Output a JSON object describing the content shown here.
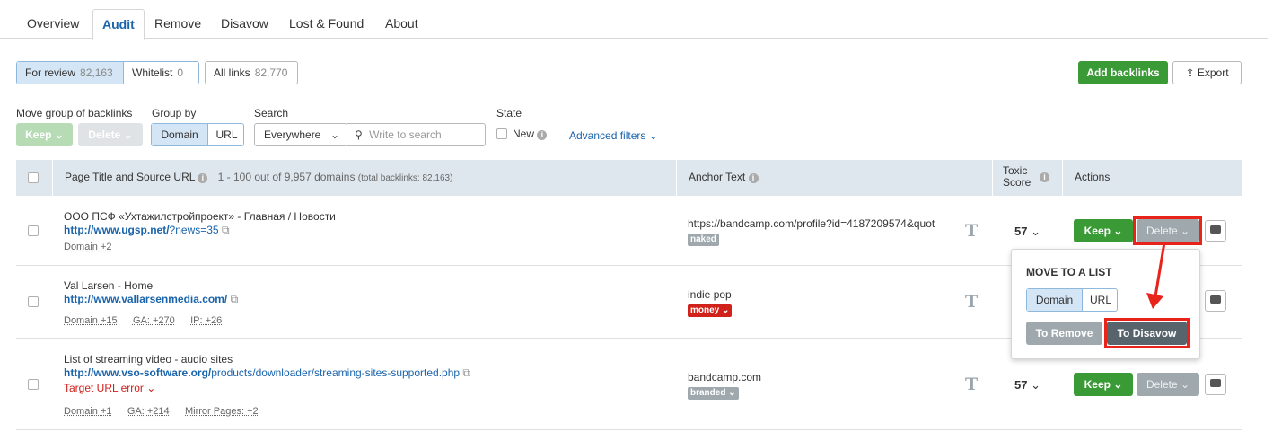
{
  "tabs": [
    "Overview",
    "Audit",
    "Remove",
    "Disavow",
    "Lost & Found",
    "About"
  ],
  "filters": {
    "for_review": "For review",
    "for_review_count": "82,163",
    "whitelist": "Whitelist",
    "whitelist_count": "0",
    "all_links": "All links",
    "all_links_count": "82,770"
  },
  "top_actions": {
    "add_backlinks": "Add backlinks",
    "export": "Export"
  },
  "controls": {
    "move_group_label": "Move group of backlinks",
    "keep": "Keep",
    "delete": "Delete",
    "group_by_label": "Group by",
    "domain": "Domain",
    "url": "URL",
    "search_label": "Search",
    "everywhere": "Everywhere",
    "search_placeholder": "Write to search",
    "state_label": "State",
    "new": "New",
    "advanced_filters": "Advanced filters"
  },
  "table": {
    "col_page": "Page Title and Source URL",
    "col_count": "1 - 100 out of 9,957 domains",
    "col_total": "(total backlinks: 82,163)",
    "col_anchor": "Anchor Text",
    "col_toxic_1": "Toxic",
    "col_toxic_2": "Score",
    "col_actions": "Actions"
  },
  "rows": [
    {
      "title": "ООО ПСФ «Ухтажилстройпроект» - Главная / Новости",
      "url_bold": "http://www.ugsp.net/",
      "url_rest": "?news=35",
      "meta": [
        "Domain +2"
      ],
      "anchor": "https://bandcamp.com/profile?id=4187209574&quot",
      "tag": "naked",
      "score": "57"
    },
    {
      "title": "Val Larsen - Home",
      "url_bold": "http://www.vallarsenmedia.com/",
      "url_rest": "",
      "meta": [
        "Domain +15",
        "GA: +270",
        "IP: +26"
      ],
      "anchor": "indie pop",
      "tag": "money"
    },
    {
      "title": "List of streaming video - audio sites",
      "url_bold": "http://www.vso-software.org/",
      "url_rest": "products/downloader/streaming-sites-supported.php",
      "error": "Target URL error",
      "meta": [
        "Domain +1",
        "GA: +214",
        "Mirror Pages: +2"
      ],
      "anchor": "bandcamp.com",
      "tag": "branded",
      "score": "57"
    }
  ],
  "popup": {
    "title": "MOVE TO A LIST",
    "domain": "Domain",
    "url": "URL",
    "to_remove": "To Remove",
    "to_disavow": "To Disavow"
  },
  "colors": {
    "green": "#3a9a36",
    "link": "#1a64ab",
    "highlight": "#e8231a",
    "money": "#d0211b",
    "tag_gray": "#9ea8ad"
  }
}
